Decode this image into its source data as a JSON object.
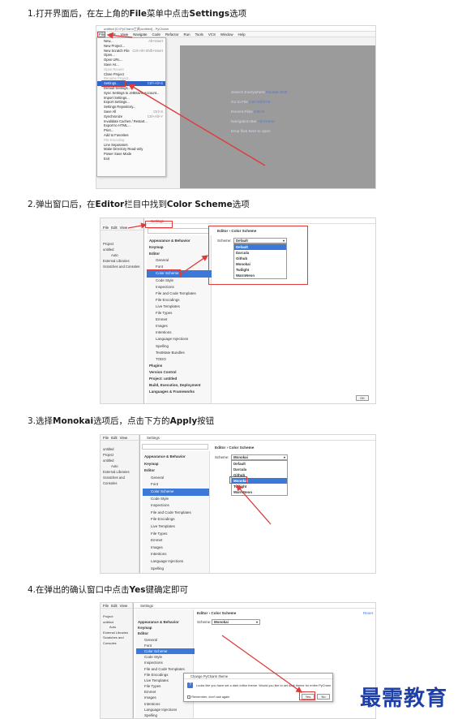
{
  "steps": [
    {
      "prefix": "1.打开界面后，在左上角的",
      "strong": "File",
      "middle": "菜单中点击",
      "strong2": "Settings",
      "suffix": "选项"
    },
    {
      "prefix": "2.弹出窗口后，在",
      "strong": "Editor",
      "middle": "栏目中找到",
      "strong2": "Color Scheme",
      "suffix": "选项"
    },
    {
      "prefix": "3.选择",
      "strong": "Monokai",
      "middle": "选项后，点击下方的",
      "strong2": "Apply",
      "suffix": "按钮"
    },
    {
      "prefix": "4.在弹出的确认窗口中点击",
      "strong": "Yes",
      "middle": "键确定即可",
      "strong2": "",
      "suffix": ""
    }
  ],
  "shot1": {
    "window_title": "untitled [D:\\PyCharm工具\\untitled] - PyCharm",
    "menubar": [
      "File",
      "Edit",
      "View",
      "Navigate",
      "Code",
      "Refactor",
      "Run",
      "Tools",
      "VCS",
      "Window",
      "Help"
    ],
    "file_menu": [
      {
        "label": "New...",
        "shortcut": "Alt+Insert"
      },
      {
        "label": "New Project...",
        "shortcut": ""
      },
      {
        "label": "New Scratch File",
        "shortcut": "Ctrl+Alt+Shift+Insert"
      },
      {
        "label": "Open...",
        "shortcut": ""
      },
      {
        "label": "Open URL...",
        "shortcut": ""
      },
      {
        "label": "Save As...",
        "shortcut": ""
      },
      {
        "label": "Open Recent",
        "shortcut": ""
      },
      {
        "label": "Close Project",
        "shortcut": ""
      },
      {
        "label": "Rename Project...",
        "shortcut": ""
      },
      {
        "label": "Settings...",
        "shortcut": "Ctrl+Alt+S"
      },
      {
        "label": "Default Settings...",
        "shortcut": ""
      },
      {
        "label": "Sync Settings to JetBrains Account...",
        "shortcut": ""
      },
      {
        "label": "Import Settings...",
        "shortcut": ""
      },
      {
        "label": "Export Settings...",
        "shortcut": ""
      },
      {
        "label": "Settings Repository...",
        "shortcut": ""
      },
      {
        "label": "Save All",
        "shortcut": "Ctrl+S"
      },
      {
        "label": "Synchronize",
        "shortcut": "Ctrl+Alt+Y"
      },
      {
        "label": "Invalidate Caches / Restart...",
        "shortcut": ""
      },
      {
        "label": "Export to HTML...",
        "shortcut": ""
      },
      {
        "label": "Print...",
        "shortcut": ""
      },
      {
        "label": "Add to Favorites",
        "shortcut": ""
      },
      {
        "label": "File Encoding",
        "shortcut": ""
      },
      {
        "label": "Line Separators",
        "shortcut": ""
      },
      {
        "label": "Make Directory Read-only",
        "shortcut": ""
      },
      {
        "label": "Power Save Mode",
        "shortcut": ""
      },
      {
        "label": "Exit",
        "shortcut": ""
      }
    ],
    "hints": [
      {
        "text": "Search Everywhere",
        "key": "Double Shift"
      },
      {
        "text": "Go to File",
        "key": "Ctrl+Shift+N"
      },
      {
        "text": "Recent Files",
        "key": "Ctrl+E"
      },
      {
        "text": "Navigation Bar",
        "key": "Alt+Home"
      },
      {
        "text": "Drop files here to open",
        "key": ""
      }
    ]
  },
  "settings": {
    "window_title": "Settings",
    "breadcrumb_editor": "Editor",
    "breadcrumb_sep": "›",
    "breadcrumb_page": "Color Scheme",
    "scheme_label": "Scheme:",
    "scheme_default": "Default",
    "scheme_monokai": "Monokai",
    "scheme_options": [
      "Default",
      "Darcula",
      "Github",
      "Monokai",
      "Twilight",
      "WarmNeon"
    ],
    "tree": [
      {
        "label": "Appearance & Behavior",
        "bold": true,
        "level": 0
      },
      {
        "label": "Keymap",
        "bold": true,
        "level": 0
      },
      {
        "label": "Editor",
        "bold": true,
        "level": 0
      },
      {
        "label": "General",
        "bold": false,
        "level": 1
      },
      {
        "label": "Font",
        "bold": false,
        "level": 1
      },
      {
        "label": "Color Scheme",
        "bold": false,
        "level": 1
      },
      {
        "label": "Code Style",
        "bold": false,
        "level": 1
      },
      {
        "label": "Inspections",
        "bold": false,
        "level": 1
      },
      {
        "label": "File and Code Templates",
        "bold": false,
        "level": 1
      },
      {
        "label": "File Encodings",
        "bold": false,
        "level": 1
      },
      {
        "label": "Live Templates",
        "bold": false,
        "level": 1
      },
      {
        "label": "File Types",
        "bold": false,
        "level": 1
      },
      {
        "label": "Emmet",
        "bold": false,
        "level": 1
      },
      {
        "label": "Images",
        "bold": false,
        "level": 1
      },
      {
        "label": "Intentions",
        "bold": false,
        "level": 1
      },
      {
        "label": "Language Injections",
        "bold": false,
        "level": 1
      },
      {
        "label": "Spelling",
        "bold": false,
        "level": 1
      },
      {
        "label": "TextMate Bundles",
        "bold": false,
        "level": 1
      },
      {
        "label": "TODO",
        "bold": false,
        "level": 1
      },
      {
        "label": "Plugins",
        "bold": true,
        "level": 0
      },
      {
        "label": "Version Control",
        "bold": true,
        "level": 0
      },
      {
        "label": "Project: untitled",
        "bold": true,
        "level": 0
      },
      {
        "label": "Build, Execution, Deployment",
        "bold": true,
        "level": 0
      },
      {
        "label": "Languages & Frameworks",
        "bold": true,
        "level": 0
      }
    ],
    "project_panel": [
      "Project",
      "untitled",
      "Auto",
      "External Libraries",
      "Scratches and Consoles"
    ],
    "ok_label": "OK",
    "menubar": [
      "File",
      "Edit",
      "View",
      "Navigate"
    ]
  },
  "dialog": {
    "title": "Change PyCharm theme",
    "message": "Looks like you have set a dark editor theme. Would you like to set dark theme for entire PyCharm",
    "checkbox": "Remember, don't ask again",
    "yes": "Yes",
    "no": "No",
    "reset": "Reset"
  },
  "watermark": "最需教育"
}
